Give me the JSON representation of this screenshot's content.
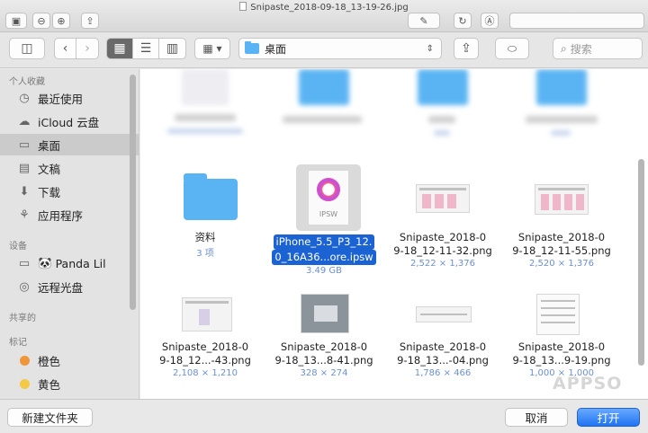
{
  "window": {
    "title": "Snipaste_2018-09-18_13-19-26.jpg"
  },
  "toolbar": {
    "location": "桌面",
    "search_placeholder": "搜索"
  },
  "sidebar": {
    "sections": [
      {
        "title": "个人收藏",
        "items": [
          {
            "label": "最近使用",
            "icon": "clock-icon"
          },
          {
            "label": "iCloud 云盘",
            "icon": "cloud-icon"
          },
          {
            "label": "桌面",
            "icon": "desktop-icon",
            "selected": true
          },
          {
            "label": "文稿",
            "icon": "document-icon"
          },
          {
            "label": "下载",
            "icon": "download-icon"
          },
          {
            "label": "应用程序",
            "icon": "applications-icon"
          }
        ]
      },
      {
        "title": "设备",
        "items": [
          {
            "label": "Panda Lil",
            "icon": "panda-icon"
          },
          {
            "label": "远程光盘",
            "icon": "disc-icon"
          }
        ]
      },
      {
        "title": "共享的",
        "items": []
      },
      {
        "title": "标记",
        "items": [
          {
            "label": "橙色",
            "color": "#f0963a"
          },
          {
            "label": "黄色",
            "color": "#f3c945"
          }
        ]
      }
    ]
  },
  "files": [
    {
      "name1": "资料",
      "name2": "",
      "meta": "3 项",
      "kind": "folder"
    },
    {
      "name1": "iPhone_5.5_P3_12.",
      "name2": "0_16A36...ore.ipsw",
      "meta": "3.49 GB",
      "kind": "ipsw",
      "selected": true
    },
    {
      "name1": "Snipaste_2018-0",
      "name2": "9-18_12-11-32.png",
      "meta": "2,522 × 1,376",
      "kind": "image"
    },
    {
      "name1": "Snipaste_2018-0",
      "name2": "9-18_12-11-55.png",
      "meta": "2,520 × 1,376",
      "kind": "image"
    },
    {
      "name1": "Snipaste_2018-0",
      "name2": "9-18_12...-43.png",
      "meta": "2,108 × 1,210",
      "kind": "image"
    },
    {
      "name1": "Snipaste_2018-0",
      "name2": "9-18_13...8-41.png",
      "meta": "328 × 274",
      "kind": "image"
    },
    {
      "name1": "Snipaste_2018-0",
      "name2": "9-18_13...-04.png",
      "meta": "1,786 × 466",
      "kind": "image"
    },
    {
      "name1": "Snipaste_2018-0",
      "name2": "9-18_13...9-19.png",
      "meta": "1,000 × 1,000",
      "kind": "image"
    }
  ],
  "footer": {
    "new_folder": "新建文件夹",
    "cancel": "取消",
    "open": "打开"
  },
  "watermark": "APPSO"
}
